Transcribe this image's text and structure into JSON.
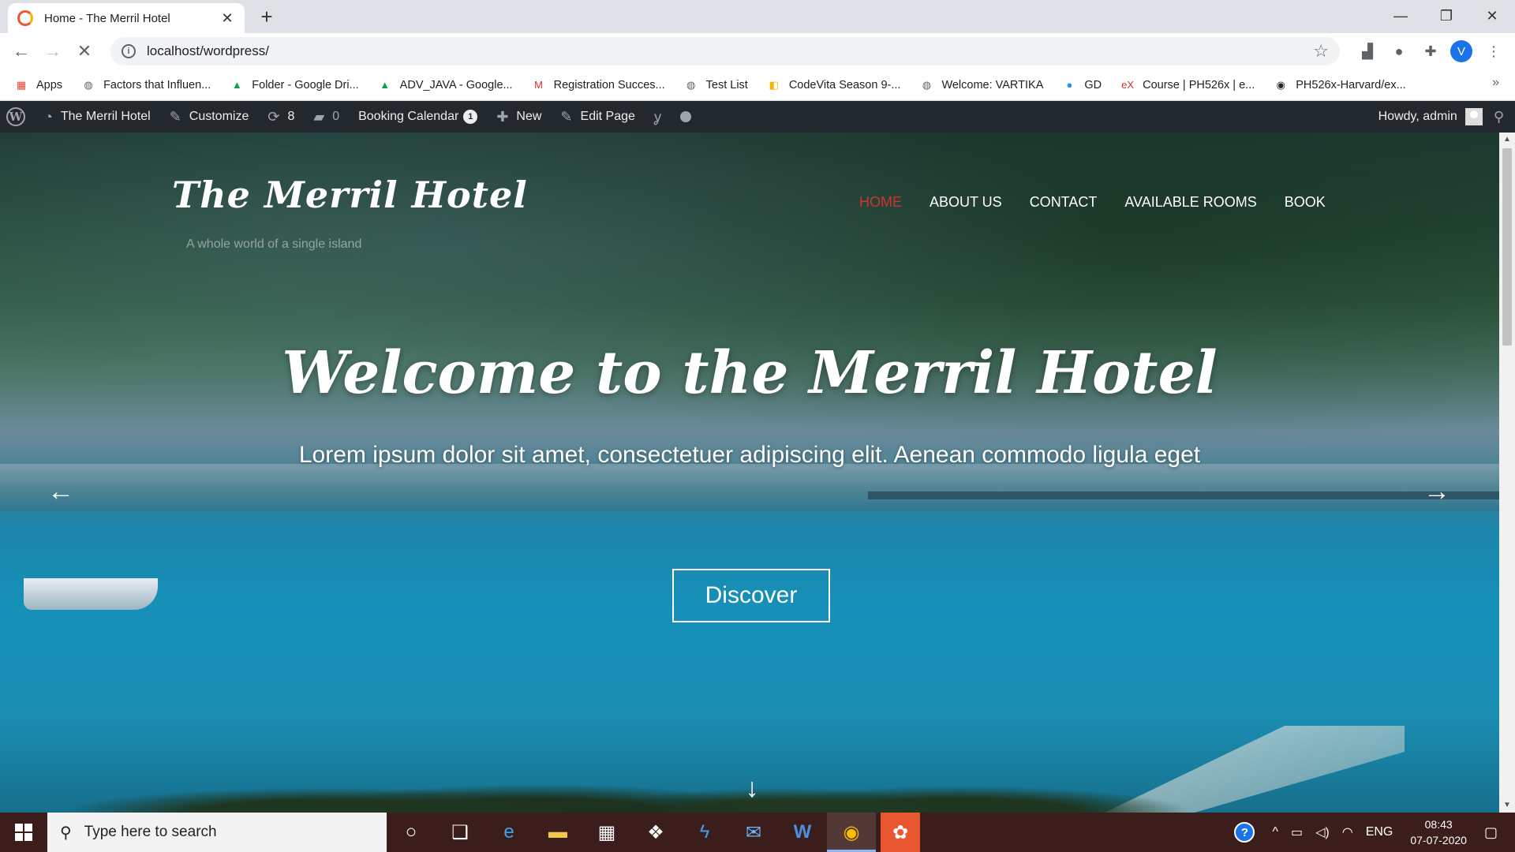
{
  "browser": {
    "tab_title": "Home - The Merril Hotel",
    "url": "localhost/wordpress/",
    "profile_initial": "V",
    "bookmarks": [
      {
        "label": "Apps",
        "icon": "apps-grid-icon",
        "color": "#ea4335"
      },
      {
        "label": "Factors that Influen...",
        "icon": "globe-icon",
        "color": "#5f6368"
      },
      {
        "label": "Folder - Google Dri...",
        "icon": "google-drive-icon",
        "color": "#0f9d58"
      },
      {
        "label": "ADV_JAVA - Google...",
        "icon": "google-drive-icon",
        "color": "#0f9d58"
      },
      {
        "label": "Registration Succes...",
        "icon": "gmail-icon",
        "color": "#d93025"
      },
      {
        "label": "Test List",
        "icon": "globe-icon",
        "color": "#5f6368"
      },
      {
        "label": "CodeVita Season 9-...",
        "icon": "codevita-icon",
        "color": "#f4b400"
      },
      {
        "label": "Welcome: VARTIKA",
        "icon": "globe-icon",
        "color": "#5f6368"
      },
      {
        "label": "GD",
        "icon": "zoom-icon",
        "color": "#2d8cff"
      },
      {
        "label": "Course | PH526x | e...",
        "icon": "edx-icon",
        "color": "#d32f2f"
      },
      {
        "label": "PH526x-Harvard/ex...",
        "icon": "github-icon",
        "color": "#24292e"
      }
    ],
    "bookmarks_more": "»"
  },
  "adminbar": {
    "site_name": "The Merril Hotel",
    "customize": "Customize",
    "updates": "8",
    "comments": "0",
    "booking_calendar": "Booking Calendar",
    "booking_badge": "1",
    "new": "New",
    "edit_page": "Edit Page",
    "howdy": "Howdy, admin"
  },
  "site": {
    "title": "The Merril Hotel",
    "tagline": "A whole world of a single island",
    "nav": [
      "HOME",
      "ABOUT US",
      "CONTACT",
      "AVAILABLE ROOMS",
      "BOOK"
    ],
    "active_nav": "HOME"
  },
  "hero": {
    "title": "Welcome to the Merril Hotel",
    "subtitle": "Lorem ipsum dolor sit amet, consectetuer adipiscing elit. Aenean commodo ligula eget",
    "button": "Discover",
    "prev": "←",
    "next": "→",
    "scroll_down": "↓"
  },
  "taskbar": {
    "search_placeholder": "Type here to search",
    "language": "ENG",
    "time": "08:43",
    "date": "07-07-2020"
  },
  "colors": {
    "accent_active_nav": "#d0342c",
    "adminbar_bg": "#23282d",
    "taskbar_bg": "#3b1e1b"
  }
}
